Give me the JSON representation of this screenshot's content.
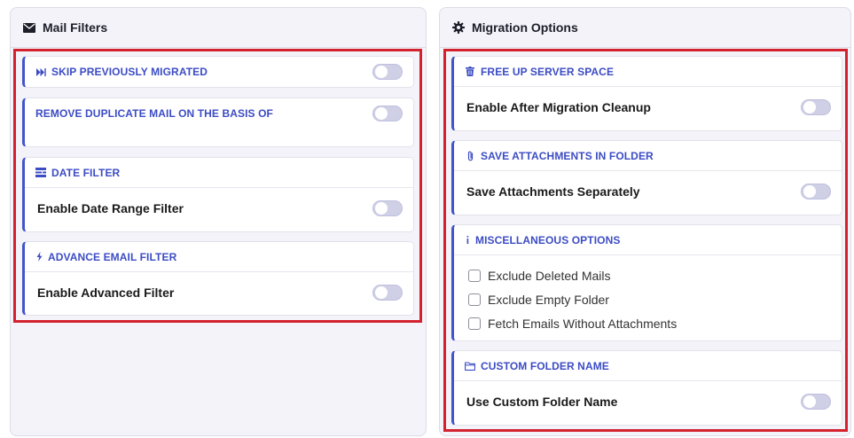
{
  "mail_filters": {
    "title": "Mail Filters",
    "skip_migrated": {
      "label": "SKIP PREVIOUSLY MIGRATED",
      "enabled": false
    },
    "remove_duplicate": {
      "label": "REMOVE DUPLICATE MAIL ON THE BASIS OF",
      "enabled": false
    },
    "date_filter": {
      "title": "DATE FILTER",
      "option": "Enable Date Range Filter",
      "enabled": false
    },
    "advance_filter": {
      "title": "ADVANCE EMAIL FILTER",
      "option": "Enable Advanced Filter",
      "enabled": false
    }
  },
  "migration_options": {
    "title": "Migration Options",
    "free_space": {
      "title": "FREE UP SERVER SPACE",
      "option": "Enable After Migration Cleanup",
      "enabled": false
    },
    "save_attachments": {
      "title": "SAVE ATTACHMENTS IN FOLDER",
      "option": "Save Attachments Separately",
      "enabled": false
    },
    "misc": {
      "title": "MISCELLANEOUS OPTIONS",
      "items": [
        {
          "label": "Exclude Deleted Mails",
          "checked": false
        },
        {
          "label": "Exclude Empty Folder",
          "checked": false
        },
        {
          "label": "Fetch Emails Without Attachments",
          "checked": false
        }
      ]
    },
    "custom_folder": {
      "title": "CUSTOM FOLDER NAME",
      "option": "Use Custom Folder Name",
      "enabled": false
    }
  },
  "colors": {
    "accent": "#3c4cc4",
    "highlight": "#d3222e",
    "panel_bg": "#f3f3f9"
  },
  "icons": {
    "mail_filters": "envelope-icon",
    "migration_options": "gear-icon",
    "skip": "fast-forward-icon",
    "date": "calendar-icon",
    "advance": "lightning-icon",
    "free_space": "trash-icon",
    "attachments": "paperclip-icon",
    "misc": "info-icon",
    "custom_folder": "folder-icon"
  }
}
